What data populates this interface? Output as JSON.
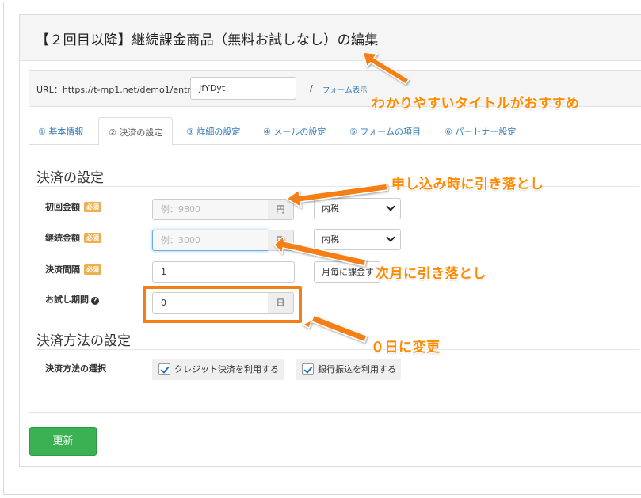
{
  "page": {
    "title": "【２回目以降】継続課金商品（無料お試しなし）の編集"
  },
  "url_bar": {
    "label": "URL：https://t-mp1.net/demo1/entry/",
    "slug_value": "JfYDyt",
    "slash": "/",
    "preview_link": "フォーム表示"
  },
  "tabs": [
    {
      "label": "① 基本情報",
      "active": false
    },
    {
      "label": "② 決済の設定",
      "active": true
    },
    {
      "label": "③ 詳細の設定",
      "active": false
    },
    {
      "label": "④ メールの設定",
      "active": false
    },
    {
      "label": "⑤ フォームの項目",
      "active": false
    },
    {
      "label": "⑥ パートナー設定",
      "active": false
    }
  ],
  "payment_settings": {
    "heading": "決済の設定",
    "required_badge": "必須",
    "initial_amount": {
      "label": "初回金額",
      "placeholder": "例：9800",
      "unit": "円",
      "tax_option": "内税"
    },
    "recurring_amount": {
      "label": "継続金額",
      "placeholder": "例：3000",
      "unit": "円",
      "tax_option": "内税"
    },
    "interval": {
      "label": "決済間隔",
      "value": "1",
      "option": "月毎に課金す"
    },
    "trial_period": {
      "label": "お試し期間",
      "help_icon": "?",
      "value": "0",
      "unit": "日"
    }
  },
  "payment_methods": {
    "heading": "決済方法の設定",
    "label": "決済方法の選択",
    "options": [
      {
        "label": "クレジット決済を利用する",
        "checked": true
      },
      {
        "label": "銀行振込を利用する",
        "checked": true
      }
    ]
  },
  "footer": {
    "update_button": "更新"
  },
  "annotations": {
    "title_tip": "わかりやすいタイトルがおすすめ",
    "initial_tip": "申し込み時に引き落とし",
    "recurring_tip": "次月に引き落とし",
    "trial_tip": "０日に変更",
    "color": "#ff8a00"
  }
}
